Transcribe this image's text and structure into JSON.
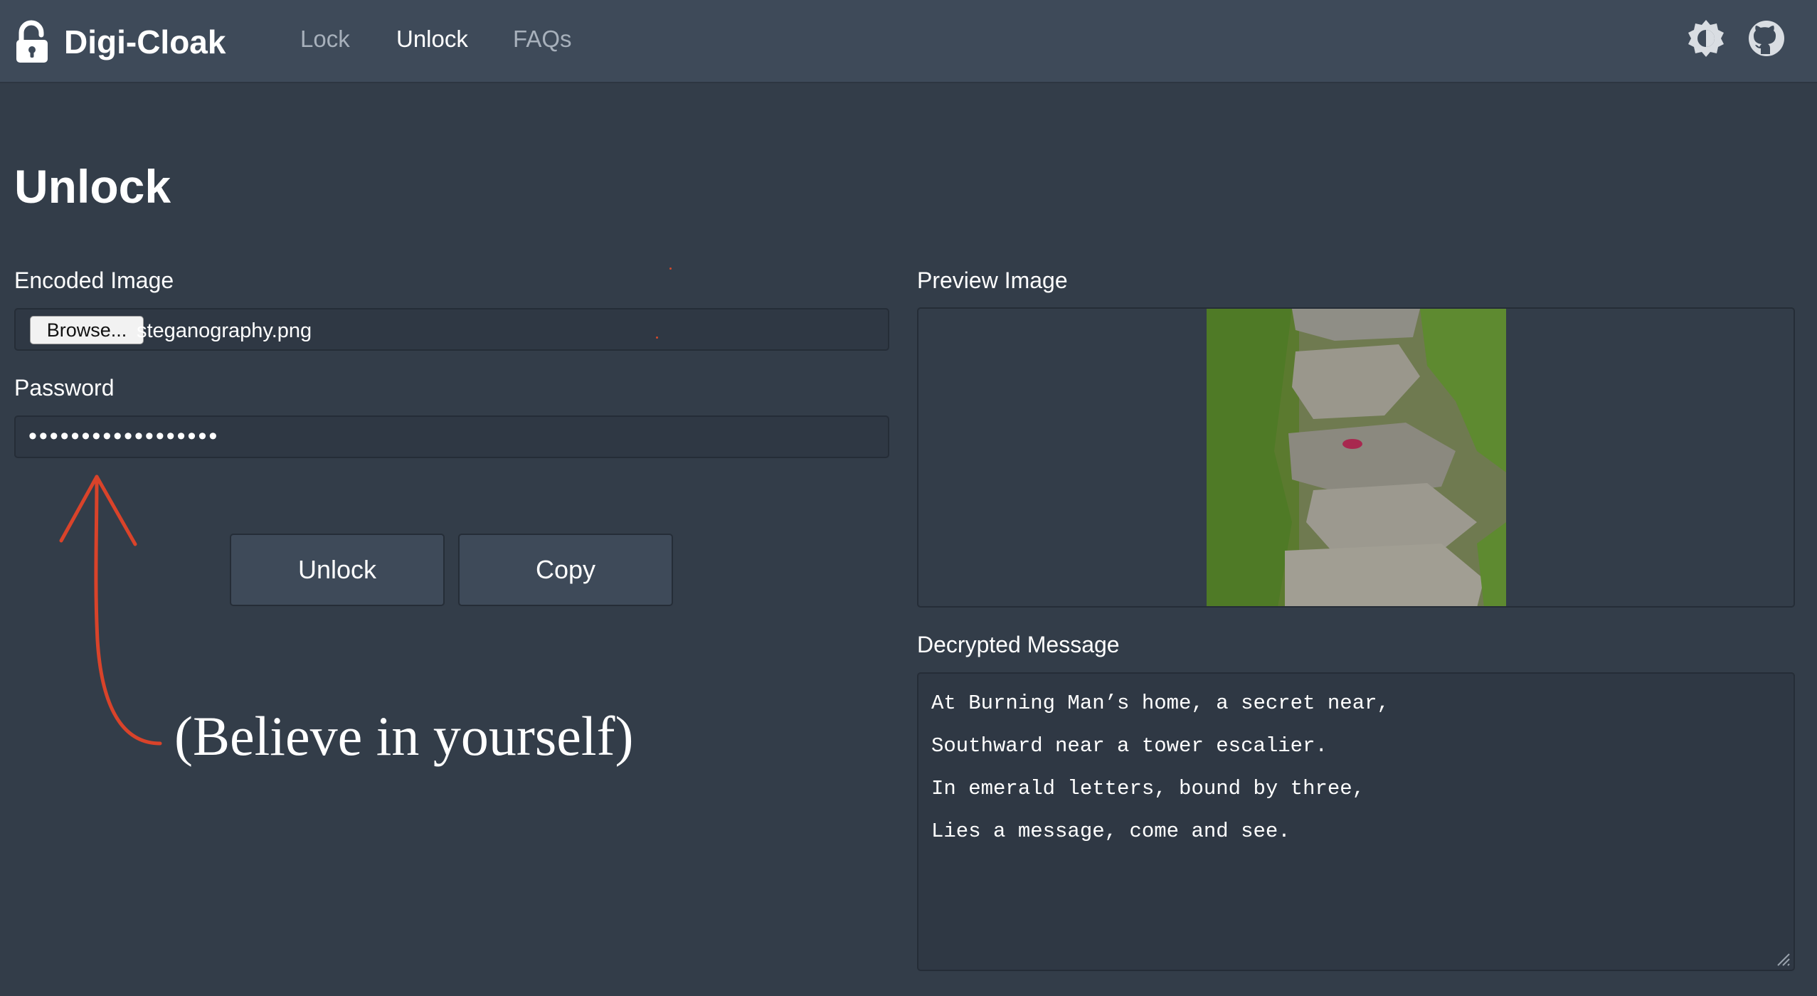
{
  "navbar": {
    "brand": "Digi-Cloak",
    "links": [
      "Lock",
      "Unlock",
      "FAQs"
    ],
    "active_link": "Unlock",
    "icons": [
      "theme-toggle-icon",
      "github-icon"
    ]
  },
  "page": {
    "title": "Unlock"
  },
  "form": {
    "encoded_image_label": "Encoded Image",
    "browse_label": "Browse...",
    "file_name": "steganography.png",
    "password_label": "Password",
    "password_value": "••••••••••••••••••"
  },
  "buttons": {
    "unlock": "Unlock",
    "copy": "Copy"
  },
  "annotation": {
    "text": "(Believe in yourself)",
    "color": "#d9432a"
  },
  "preview": {
    "label": "Preview Image"
  },
  "decrypted": {
    "label": "Decrypted Message",
    "lines": [
      "At Burning Man’s home, a secret near,",
      "Southward near a tower escalier.",
      "In emerald letters, bound by three,",
      "Lies a message, come and see."
    ]
  },
  "colors": {
    "navbar_bg": "#3e4a59",
    "page_bg": "#333d49",
    "field_bg": "#2f3844"
  }
}
